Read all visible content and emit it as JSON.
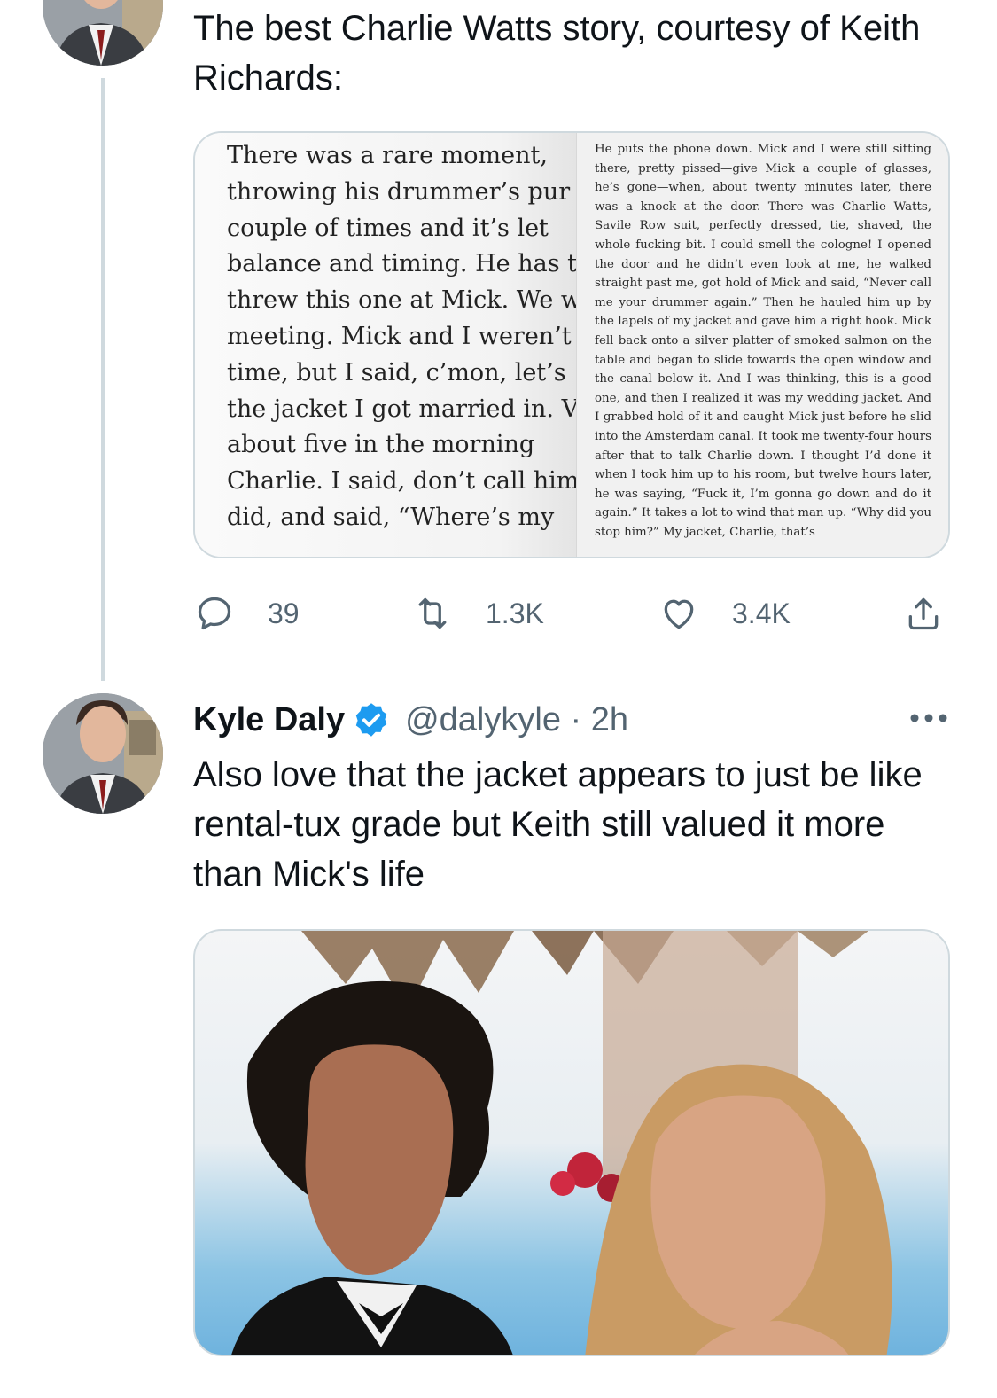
{
  "tweet1": {
    "text": "The best Charlie Watts story, courtesy of Keith Richards:",
    "book_left_lines": [
      "There was a rare moment,",
      "throwing his drummer’s pur",
      "couple of times and it’s let",
      "balance and timing. He has t",
      "threw this one at Mick. We w",
      "meeting. Mick and I weren’t",
      "time, but I said, c’mon, let’s",
      "the jacket I got married in. V",
      "about five in the morning",
      "Charlie. I said, don’t call him,",
      "did, and said, “Where’s my"
    ],
    "book_right_text": "He puts the phone down. Mick and I were still sitting there, pretty pissed—give Mick a couple of glasses, he’s gone—when, about twenty minutes later, there was a knock at the door. There was Charlie Watts, Savile Row suit, perfectly dressed, tie, shaved, the whole fucking bit. I could smell the cologne! I opened the door and he didn’t even look at me, he walked straight past me, got hold of Mick and said, “Never call me your drummer again.” Then he hauled him up by the lapels of my jacket and gave him a right hook. Mick fell back onto a silver platter of smoked salmon on the table and began to slide towards the open window and the canal below it. And I was thinking, this is a good one, and then I realized it was my wedding jacket. And I grabbed hold of it and caught Mick just before he slid into the Amsterdam canal. It took me twenty-four hours after that to talk Charlie down. I thought I’d done it when I took him up to his room, but twelve hours later, he was saying, “Fuck it, I’m gonna go down and do it again.” It takes a lot to wind that man up. “Why did you stop him?” My jacket, Charlie, that’s",
    "reply_count": "39",
    "retweet_count": "1.3K",
    "like_count": "3.4K"
  },
  "tweet2": {
    "name": "Kyle Daly",
    "handle_time": "@dalykyle · 2h",
    "text": "Also love that the jacket appears to just be like rental-tux grade but Keith still valued it more than Mick's life"
  },
  "colors": {
    "verified": "#1d9bf0",
    "secondary": "#536471",
    "border": "#cfd9de"
  },
  "icons": [
    "reply-icon",
    "retweet-icon",
    "like-icon",
    "share-icon",
    "verified-badge-icon",
    "more-icon"
  ]
}
